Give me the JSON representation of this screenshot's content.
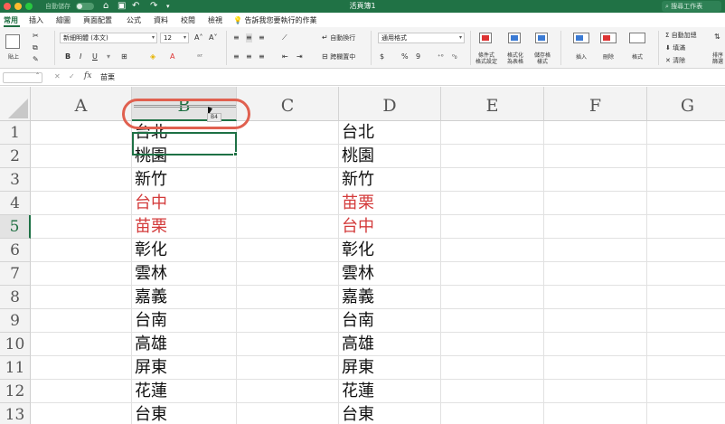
{
  "window": {
    "title": "活頁簿1",
    "autosave_label": "自動儲存",
    "autosave_state": "關閉",
    "search_placeholder": "搜尋工作表"
  },
  "tabs": [
    "常用",
    "插入",
    "繪圖",
    "頁面配置",
    "公式",
    "資料",
    "校閱",
    "檢視"
  ],
  "active_tab": "常用",
  "tell_me": "告訴我您要執行的作業",
  "ribbon": {
    "paste": "貼上",
    "font_name": "新細明體 (本文)",
    "font_size": "12",
    "font_grow": "A˄",
    "font_shrink": "A˅",
    "bold": "B",
    "italic": "I",
    "underline": "U",
    "wrap_text": "自動換行",
    "number_format": "通用格式",
    "merge_center": "跨欄置中",
    "currency": "$",
    "percent": "%",
    "comma": "9",
    "conditional_format": "條件式\n格式設定",
    "format_as_table": "格式化\n為表格",
    "cell_styles": "儲存格\n樣式",
    "insert": "插入",
    "delete": "刪除",
    "format": "格式",
    "autosum": "自動加總",
    "fill": "填滿",
    "clear": "清除",
    "sort_filter": "排序\n篩選"
  },
  "formula_bar": {
    "name_box": "",
    "cancel": "✕",
    "confirm": "✓",
    "fx": "fx",
    "content": "苗栗"
  },
  "columns": [
    "A",
    "B",
    "C",
    "D",
    "E",
    "F",
    "G"
  ],
  "selected_column": "B",
  "rows": [
    "1",
    "2",
    "3",
    "4",
    "5",
    "6",
    "7",
    "8",
    "9",
    "10",
    "11",
    "12",
    "13"
  ],
  "selected_row": "5",
  "column_b": [
    "台北",
    "桃園",
    "新竹",
    "台中",
    "苗栗",
    "彰化",
    "雲林",
    "嘉義",
    "台南",
    "高雄",
    "屏東",
    "花蓮",
    "台東"
  ],
  "column_d": [
    "台北",
    "桃園",
    "新竹",
    "苗栗",
    "台中",
    "彰化",
    "雲林",
    "嘉義",
    "台南",
    "高雄",
    "屏東",
    "花蓮",
    "台東"
  ],
  "drag_tooltip": "B4",
  "colors": {
    "excel_green": "#207245",
    "highlight_red": "#d33a3a",
    "annotation_oval": "#e0604f"
  }
}
